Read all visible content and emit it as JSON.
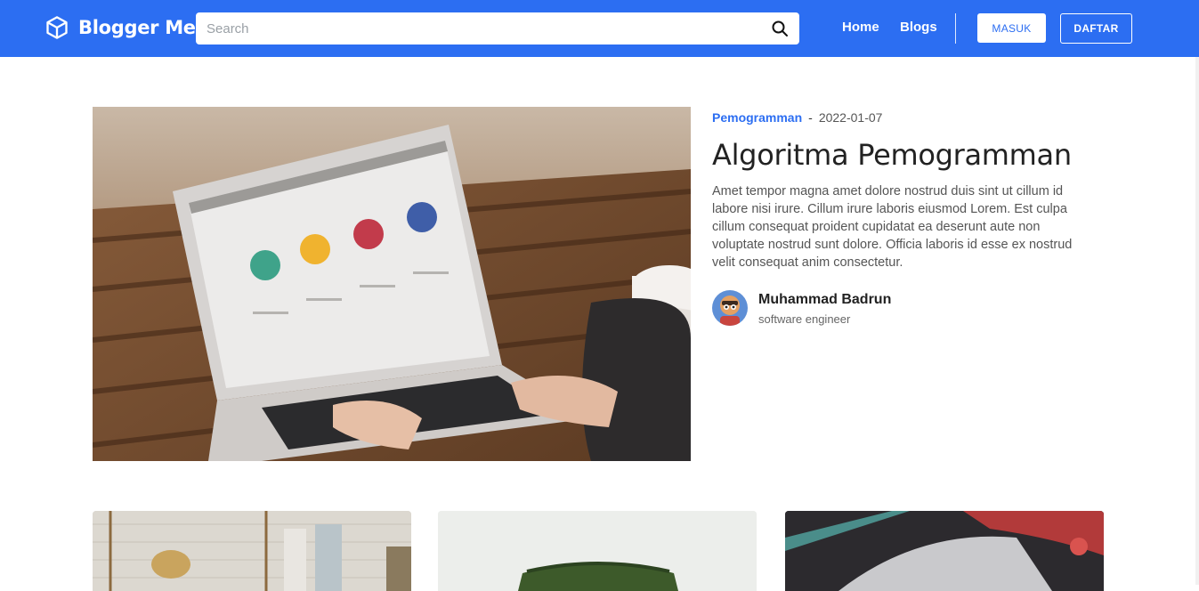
{
  "brand": {
    "name": "Blogger Me",
    "icon": "cube-icon"
  },
  "search": {
    "placeholder": "Search",
    "value": ""
  },
  "nav": {
    "links": [
      {
        "label": "Home"
      },
      {
        "label": "Blogs"
      }
    ],
    "login_label": "MASUK",
    "register_label": "DAFTAR"
  },
  "colors": {
    "primary": "#2c6ef2",
    "text_dark": "#222222",
    "text_muted": "#555555"
  },
  "featured": {
    "category": "Pemogramman",
    "separator": "-",
    "date": "2022-01-07",
    "title": "Algoritma Pemogramman",
    "excerpt": "Amet tempor magna amet dolore nostrud duis sint ut cillum id labore nisi irure. Cillum irure laboris eiusmod Lorem. Est culpa cillum consequat proident cupidatat ea deserunt aute non voluptate nostrud sunt dolore. Officia laboris id esse ex nostrud velit consequat anim consectetur.",
    "author": {
      "name": "Muhammad Badrun",
      "role": "software engineer"
    }
  }
}
